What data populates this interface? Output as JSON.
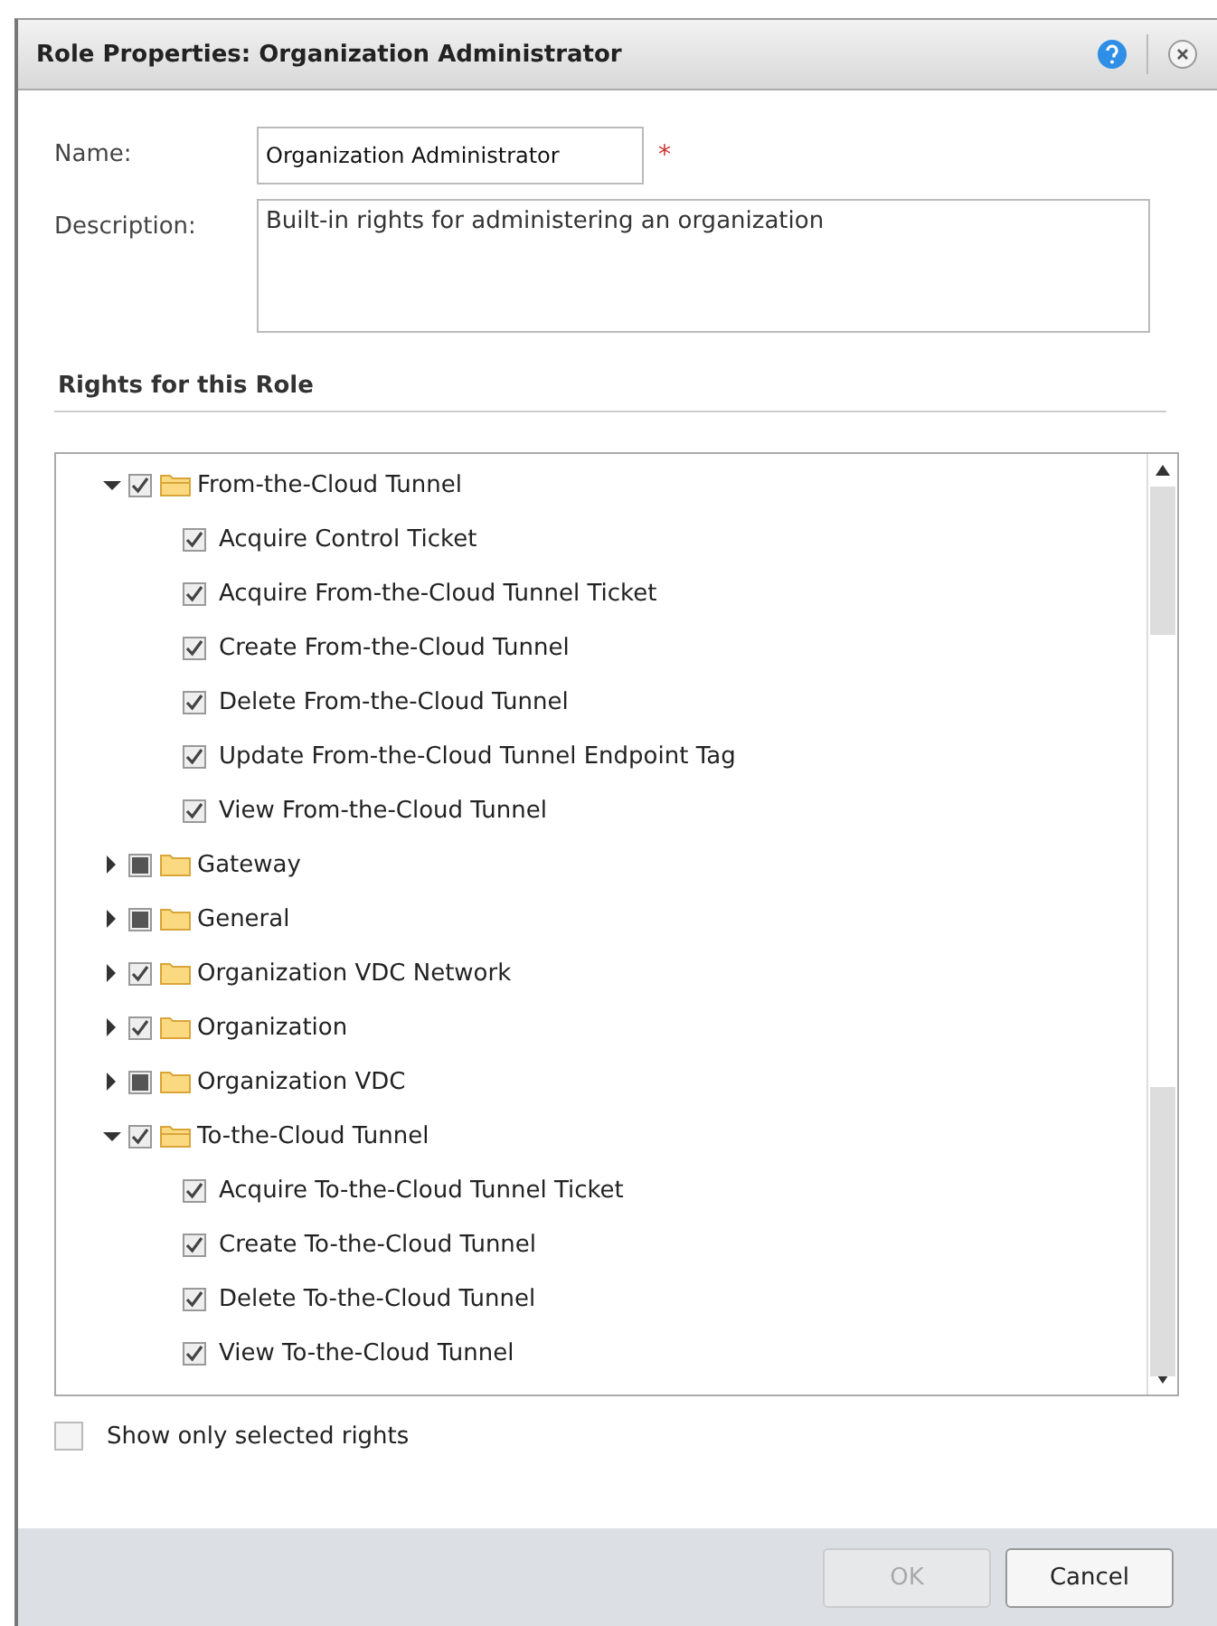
{
  "window": {
    "title": "Role Properties: Organization Administrator"
  },
  "form": {
    "name_label": "Name:",
    "name_value": "Organization Administrator",
    "required_mark": "*",
    "description_label": "Description:",
    "description_value": "Built-in rights for administering an organization"
  },
  "rights": {
    "heading": "Rights for this Role",
    "tree": [
      {
        "label": "From-the-Cloud Tunnel",
        "checked": true,
        "partial": false,
        "expanded": true,
        "children": [
          {
            "label": "Acquire Control Ticket",
            "checked": true
          },
          {
            "label": "Acquire From-the-Cloud Tunnel Ticket",
            "checked": true
          },
          {
            "label": "Create From-the-Cloud Tunnel",
            "checked": true
          },
          {
            "label": "Delete From-the-Cloud Tunnel",
            "checked": true
          },
          {
            "label": "Update From-the-Cloud Tunnel Endpoint Tag",
            "checked": true
          },
          {
            "label": "View From-the-Cloud Tunnel",
            "checked": true
          }
        ]
      },
      {
        "label": "Gateway",
        "checked": false,
        "partial": true,
        "expanded": false
      },
      {
        "label": "General",
        "checked": false,
        "partial": true,
        "expanded": false
      },
      {
        "label": "Organization VDC Network",
        "checked": true,
        "partial": false,
        "expanded": false
      },
      {
        "label": "Organization",
        "checked": true,
        "partial": false,
        "expanded": false
      },
      {
        "label": "Organization VDC",
        "checked": false,
        "partial": true,
        "expanded": false
      },
      {
        "label": "To-the-Cloud Tunnel",
        "checked": true,
        "partial": false,
        "expanded": true,
        "children": [
          {
            "label": "Acquire To-the-Cloud Tunnel Ticket",
            "checked": true
          },
          {
            "label": "Create To-the-Cloud Tunnel",
            "checked": true
          },
          {
            "label": "Delete To-the-Cloud Tunnel",
            "checked": true
          },
          {
            "label": "View To-the-Cloud Tunnel",
            "checked": true
          }
        ]
      }
    ],
    "filter": {
      "label": "Show only selected rights",
      "checked": false
    }
  },
  "buttons": [
    {
      "label": "OK",
      "disabled": true
    },
    {
      "label": "Cancel",
      "disabled": false
    }
  ]
}
